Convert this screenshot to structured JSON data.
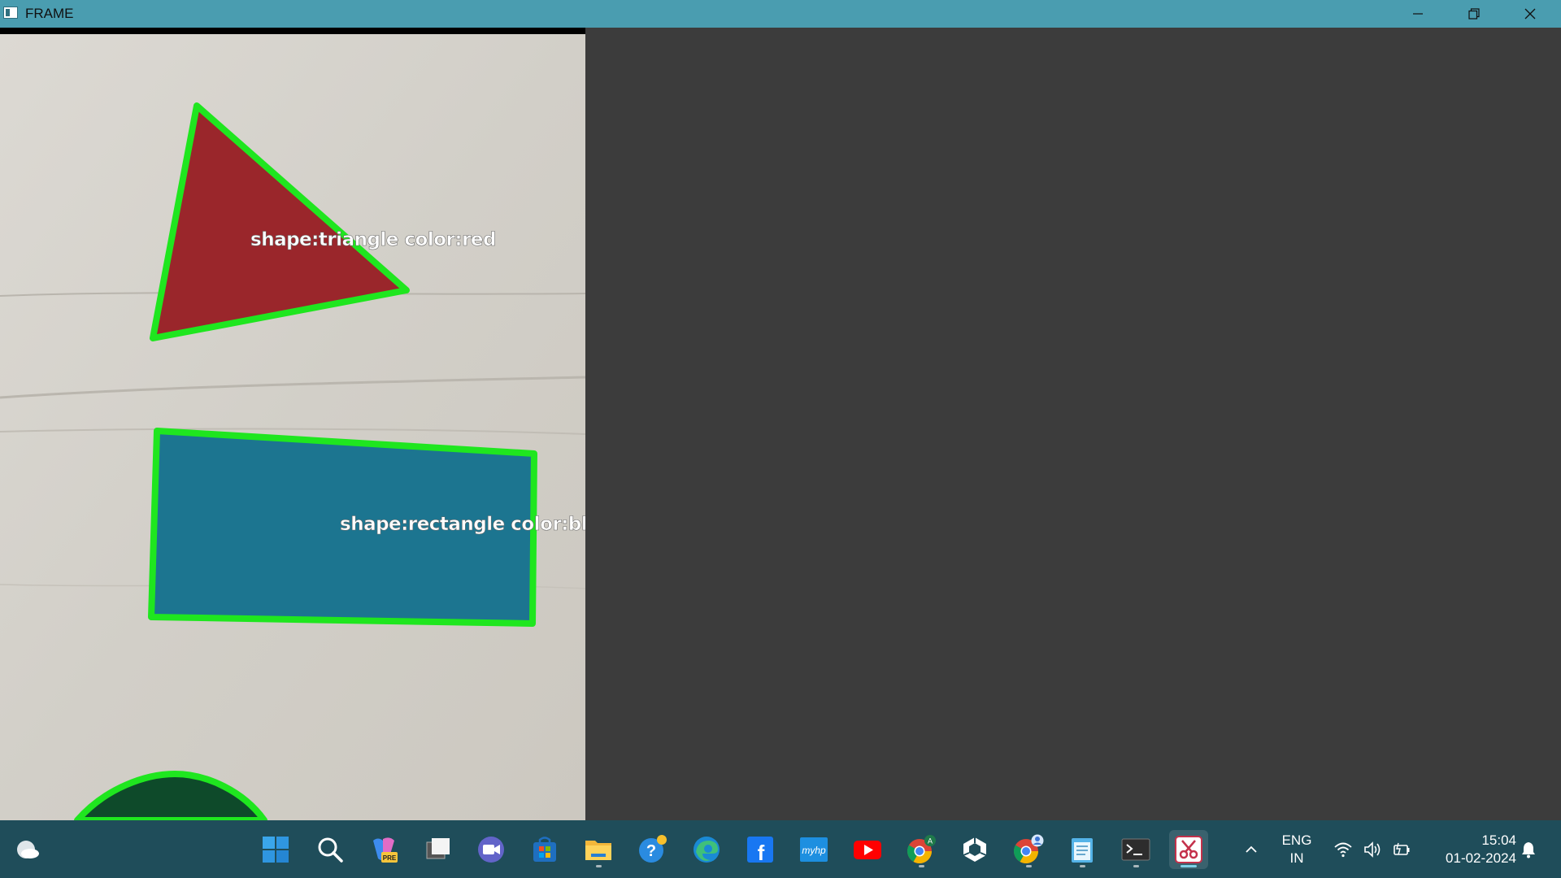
{
  "window": {
    "title": "FRAME",
    "controls": [
      "minimize-icon",
      "restore-icon",
      "close-icon"
    ]
  },
  "frame": {
    "annotations": [
      {
        "text": "shape:triangle color:red"
      },
      {
        "text": "shape:rectangle color:blue"
      }
    ],
    "colors": {
      "contour": "#1fe61f",
      "triangle": "#9a262b",
      "rectangle": "#1c7590",
      "circle": "#0e4a2a",
      "paper": "#d8d5cf"
    }
  },
  "taskbar": {
    "apps": [
      {
        "name": "weather-icon"
      },
      {
        "name": "windows-start-icon"
      },
      {
        "name": "search-icon"
      },
      {
        "name": "copilot-pre-icon"
      },
      {
        "name": "task-view-icon"
      },
      {
        "name": "teams-meet-icon"
      },
      {
        "name": "microsoft-store-icon"
      },
      {
        "name": "file-explorer-icon"
      },
      {
        "name": "help-icon"
      },
      {
        "name": "edge-icon"
      },
      {
        "name": "facebook-icon"
      },
      {
        "name": "myhp-icon"
      },
      {
        "name": "youtube-icon"
      },
      {
        "name": "chrome-icon"
      },
      {
        "name": "unity-icon"
      },
      {
        "name": "chrome-profile-icon"
      },
      {
        "name": "notepad-icon"
      },
      {
        "name": "terminal-icon"
      },
      {
        "name": "snipping-tool-icon"
      }
    ],
    "tray": {
      "lang_line1": "ENG",
      "lang_line2": "IN",
      "time": "15:04",
      "date": "01-02-2024"
    }
  }
}
